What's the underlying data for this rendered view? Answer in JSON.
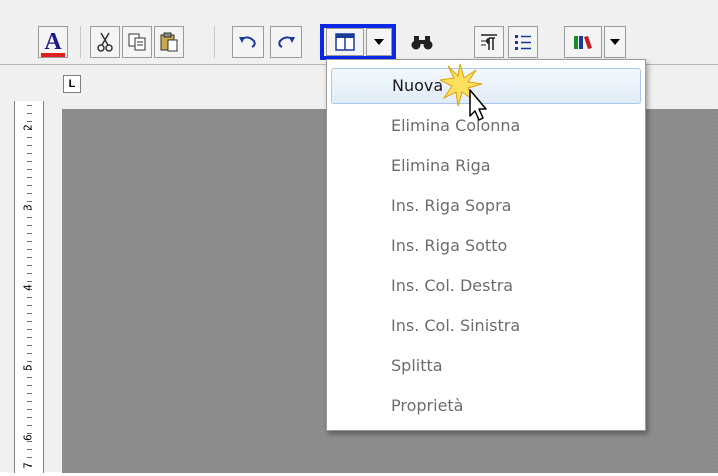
{
  "toolbar": {
    "buttons": [
      {
        "name": "font-color-button",
        "label": "A"
      },
      {
        "name": "cut-button"
      },
      {
        "name": "copy-button"
      },
      {
        "name": "paste-button"
      },
      {
        "name": "undo-button"
      },
      {
        "name": "redo-button"
      },
      {
        "name": "table-button"
      },
      {
        "name": "table-dropdown-button"
      },
      {
        "name": "find-button"
      },
      {
        "name": "paragraph-button"
      },
      {
        "name": "list-button"
      },
      {
        "name": "library-button"
      },
      {
        "name": "library-dropdown-button"
      }
    ],
    "icons": [
      "font-color-icon",
      "scissors-icon",
      "copy-icon",
      "paste-icon",
      "undo-icon",
      "redo-icon",
      "table-icon",
      "chevron-down-icon",
      "binoculars-icon",
      "paragraph-icon",
      "list-icon",
      "books-icon"
    ]
  },
  "ruler": {
    "corner_label": "L",
    "labels": [
      "2",
      "3",
      "4",
      "5",
      "6",
      "7"
    ]
  },
  "menu": {
    "items": [
      {
        "label": "Nuova",
        "active": true
      },
      {
        "label": "Elimina Colonna",
        "active": false
      },
      {
        "label": "Elimina Riga",
        "active": false
      },
      {
        "label": "Ins. Riga Sopra",
        "active": false
      },
      {
        "label": "Ins. Riga Sotto",
        "active": false
      },
      {
        "label": "Ins. Col. Destra",
        "active": false
      },
      {
        "label": "Ins. Col. Sinistra",
        "active": false
      },
      {
        "label": "Splitta",
        "active": false
      },
      {
        "label": "Proprietà",
        "active": false
      }
    ]
  },
  "colors": {
    "highlight_border": "#0a28e6",
    "font_color_bar": "#e02020",
    "canvas": "#8e8e8e",
    "menu_hover": "#e1ecf8"
  }
}
